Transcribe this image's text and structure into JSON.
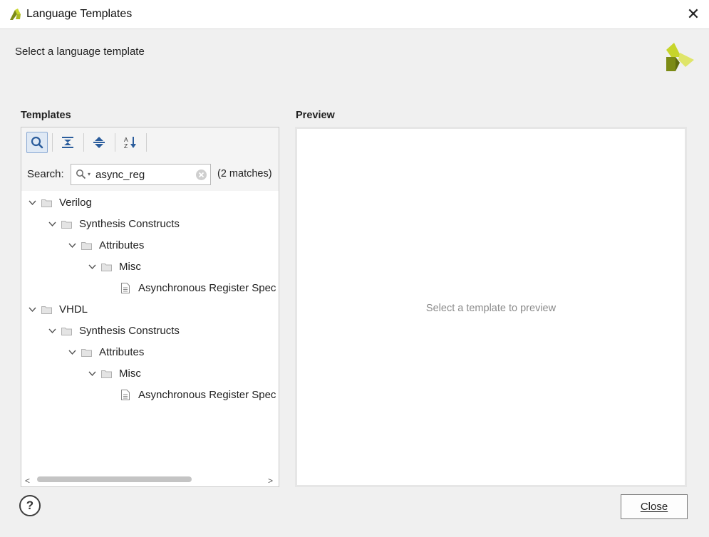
{
  "window": {
    "title": "Language Templates",
    "close_glyph": "✕"
  },
  "header": {
    "subtitle": "Select a language template",
    "brand_icon": "vivado-logo-icon"
  },
  "templates": {
    "heading": "Templates",
    "toolbar": [
      {
        "name": "search-toggle",
        "icon": "search-icon",
        "active": true
      },
      {
        "name": "collapse-all",
        "icon": "collapse-all-icon",
        "active": false
      },
      {
        "name": "expand-all",
        "icon": "expand-all-icon",
        "active": false
      },
      {
        "name": "sort",
        "icon": "sort-az-icon",
        "active": false
      }
    ],
    "search": {
      "label": "Search:",
      "value": "async_reg",
      "matches": "(2 matches)"
    },
    "tree": [
      {
        "label": "Verilog",
        "level": 0,
        "type": "folder",
        "expanded": true
      },
      {
        "label": "Synthesis Constructs",
        "level": 1,
        "type": "folder",
        "expanded": true
      },
      {
        "label": "Attributes",
        "level": 2,
        "type": "folder",
        "expanded": true
      },
      {
        "label": "Misc",
        "level": 3,
        "type": "folder",
        "expanded": true
      },
      {
        "label": "Asynchronous Register Spec",
        "level": 4,
        "type": "file"
      },
      {
        "label": "VHDL",
        "level": 0,
        "type": "folder",
        "expanded": true
      },
      {
        "label": "Synthesis Constructs",
        "level": 1,
        "type": "folder",
        "expanded": true
      },
      {
        "label": "Attributes",
        "level": 2,
        "type": "folder",
        "expanded": true
      },
      {
        "label": "Misc",
        "level": 3,
        "type": "folder",
        "expanded": true
      },
      {
        "label": "Asynchronous Register Spec",
        "level": 4,
        "type": "file"
      }
    ]
  },
  "preview": {
    "heading": "Preview",
    "placeholder": "Select a template to preview"
  },
  "footer": {
    "help_label": "?",
    "close_label": "Close"
  },
  "colors": {
    "logo_yellow": "#c7d52b",
    "logo_olive": "#7c8b15",
    "toolbar_icon": "#2b5d9c",
    "active_button_bg": "#dfe9f5"
  }
}
